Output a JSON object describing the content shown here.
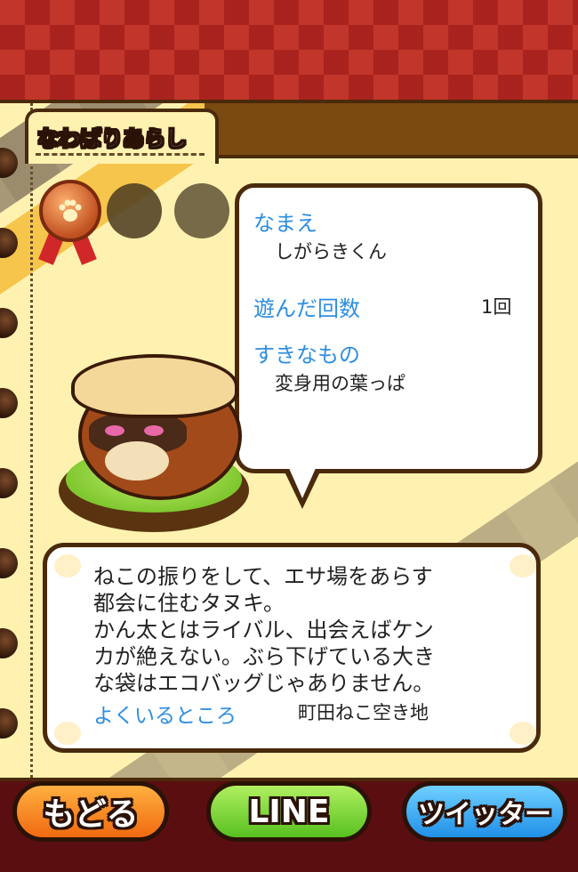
{
  "header": {
    "title": "なわばりあらし"
  },
  "profile": {
    "name_label": "なまえ",
    "name_value": "しがらきくん",
    "played_label": "遊んだ回数",
    "played_value": "1回",
    "likes_label": "すきなもの",
    "likes_value": "変身用の葉っぱ"
  },
  "description": {
    "text": "ねこの振りをして、エサ場をあらす\n都会に住むタヌキ。\nかん太とはライバル、出会えばケン\nカが絶えない。ぶら下げている大き\nな袋はエコバッグじゃありません。",
    "location_label": "よくいるところ",
    "location_value": "町田ねこ空き地"
  },
  "buttons": {
    "back_label": "もどる",
    "line_label": "LINE",
    "twitter_label": "ツイッター"
  },
  "icons": {
    "medal": "paw-medal-icon",
    "locked_medal": "locked-medal-icon",
    "character": "tanuki-character"
  },
  "colors": {
    "label_blue": "#2e8ee0",
    "background_red": "#c2352a",
    "notebook_yellow": "#fff2b0"
  }
}
